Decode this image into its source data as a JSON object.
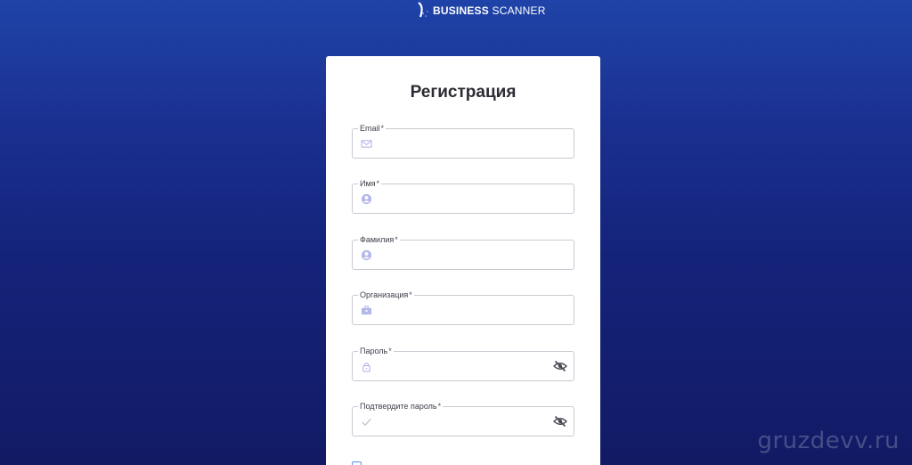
{
  "logo": {
    "text_bold": "BUSINESS",
    "text_regular": "SCANNER"
  },
  "form": {
    "title": "Регистрация",
    "fields": [
      {
        "label": "Email",
        "required": "*",
        "icon": "mail-icon",
        "value": ""
      },
      {
        "label": "Имя",
        "required": "*",
        "icon": "user-icon",
        "value": ""
      },
      {
        "label": "Фамилия",
        "required": "*",
        "icon": "user-icon",
        "value": ""
      },
      {
        "label": "Организация",
        "required": "*",
        "icon": "briefcase-icon",
        "value": ""
      },
      {
        "label": "Пароль",
        "required": "*",
        "icon": "lock-icon",
        "value": ""
      },
      {
        "label": "Подтвердите пароль",
        "required": "*",
        "icon": "check-icon",
        "value": ""
      }
    ]
  },
  "watermark": "gruzdevv.ru",
  "colors": {
    "accent": "#5b8def",
    "icon": "#b4b7ea"
  }
}
